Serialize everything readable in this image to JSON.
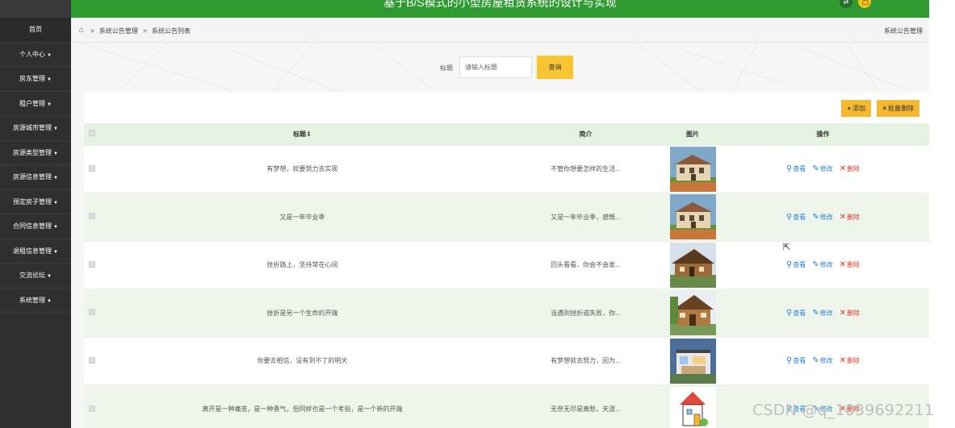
{
  "app": {
    "title": "基于B/S模式的小型房屋租赁系统的设计与实现",
    "brand_color": "#2e9a30",
    "accent_color": "#f7c531"
  },
  "sidebar": {
    "items": [
      {
        "label": "首页",
        "has_caret": false
      },
      {
        "label": "个人中心",
        "has_caret": true
      },
      {
        "label": "房东管理",
        "has_caret": true
      },
      {
        "label": "租户管理",
        "has_caret": true
      },
      {
        "label": "房源城市管理",
        "has_caret": true
      },
      {
        "label": "房源类型管理",
        "has_caret": true
      },
      {
        "label": "房源信息管理",
        "has_caret": true
      },
      {
        "label": "预定房子管理",
        "has_caret": true
      },
      {
        "label": "合同信息管理",
        "has_caret": true
      },
      {
        "label": "退租信息管理",
        "has_caret": true
      },
      {
        "label": "交流论坛",
        "has_caret": true
      },
      {
        "label": "系统管理",
        "has_caret": true
      }
    ]
  },
  "breadcrumb": {
    "items": [
      "系统公告管理",
      "系统公告列表"
    ],
    "separator": ">",
    "right_label": "系统公告管理"
  },
  "search": {
    "label": "标题",
    "placeholder": "请输入标题",
    "button_label": "查询"
  },
  "actions": {
    "add_label": "添加",
    "add_icon": "plus-icon",
    "batch_delete_label": "批量删除",
    "batch_delete_icon": "x-icon"
  },
  "table": {
    "headers": {
      "title": "标题⇕",
      "intro": "简介",
      "image": "图片",
      "ops": "操作"
    },
    "rows": [
      {
        "title": "有梦想，就要努力去实现",
        "intro": "不管你想要怎样的生活...",
        "image": "villa"
      },
      {
        "title": "又是一年毕业季",
        "intro": "又是一年毕业季，感慨...",
        "image": "villa"
      },
      {
        "title": "挫折路上，坚持常在心间",
        "intro": "回头看看，你会不会发...",
        "image": "log-cabin"
      },
      {
        "title": "挫折是另一个生命的开端",
        "intro": "当遇到挫折或失败，你...",
        "image": "wood-house"
      },
      {
        "title": "你要去相信，没有到不了的明天",
        "intro": "有梦想就去努力，因为...",
        "image": "modern-house"
      },
      {
        "title": "离开是一种痛苦，是一种勇气，但同样也是一个考验，是一个新的开端",
        "intro": "无奈无尽是离愁，天涯...",
        "image": "cartoon-house"
      }
    ],
    "op_labels": {
      "view": "查看",
      "edit": "修改",
      "delete": "删除"
    }
  },
  "watermark": "CSDN @q_1039692211"
}
